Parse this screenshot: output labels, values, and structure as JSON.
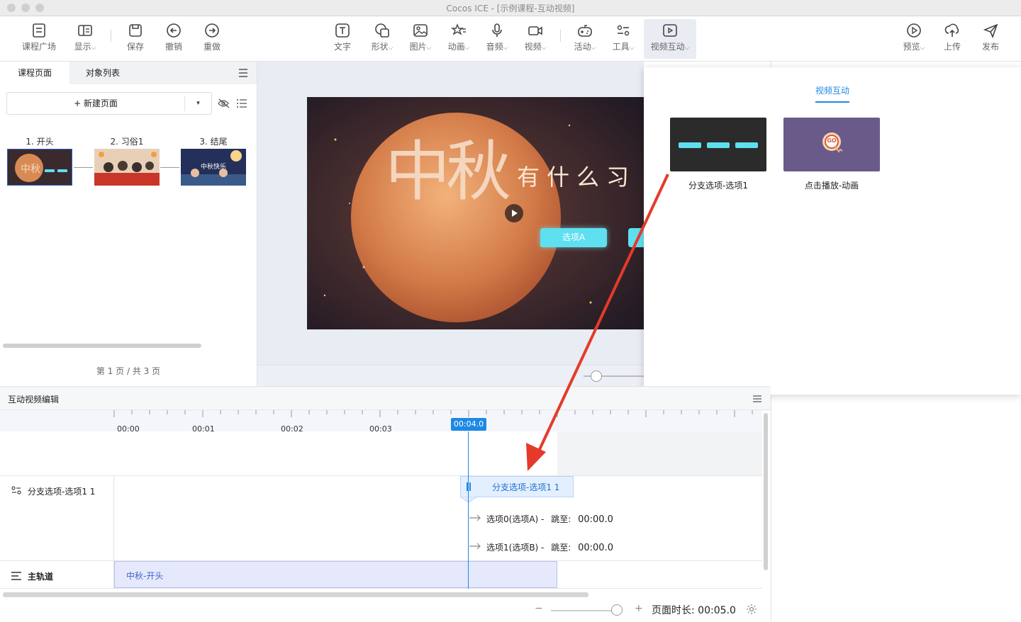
{
  "window": {
    "title": "Cocos ICE - [示例课程-互动视频]"
  },
  "toolbar": {
    "left": [
      {
        "label": "课程广场",
        "icon": "course-square-icon"
      },
      {
        "label": "显示",
        "icon": "display-icon",
        "dropdown": true
      },
      {
        "label": "保存",
        "icon": "save-icon"
      },
      {
        "label": "撤销",
        "icon": "undo-icon"
      },
      {
        "label": "重做",
        "icon": "redo-icon"
      }
    ],
    "center": [
      {
        "label": "文字",
        "icon": "text-icon"
      },
      {
        "label": "形状",
        "icon": "shape-icon",
        "dropdown": true
      },
      {
        "label": "图片",
        "icon": "image-icon",
        "dropdown": true
      },
      {
        "label": "动画",
        "icon": "animation-icon",
        "dropdown": true
      },
      {
        "label": "音频",
        "icon": "microphone-icon",
        "dropdown": true
      },
      {
        "label": "视频",
        "icon": "video-camera-icon",
        "dropdown": true
      },
      {
        "label": "活动",
        "icon": "gamepad-icon",
        "dropdown": true
      },
      {
        "label": "工具",
        "icon": "tools-icon",
        "dropdown": true
      },
      {
        "label": "视频互动",
        "icon": "video-interaction-icon",
        "dropdown": true,
        "active": true
      }
    ],
    "right": [
      {
        "label": "预览",
        "icon": "play-circle-icon",
        "dropdown": true
      },
      {
        "label": "上传",
        "icon": "upload-icon"
      },
      {
        "label": "发布",
        "icon": "send-icon"
      }
    ],
    "caret": "⌵"
  },
  "left_panel": {
    "tabs": [
      "课程页面",
      "对象列表"
    ],
    "new_page_label": "+ 新建页面",
    "dropdown_glyph": "▾",
    "pages": [
      {
        "title": "1. 开头"
      },
      {
        "title": "2. 习俗1"
      },
      {
        "title": "3. 结尾"
      }
    ],
    "page_counter": "第 1 页 / 共 3 页"
  },
  "stage": {
    "title_big": "中秋",
    "subtitle": "有什么习",
    "option_a": "选项A"
  },
  "popup": {
    "tab": "视频互动",
    "templates": [
      {
        "label": "分支选项-选项1"
      },
      {
        "label": "点击播放-动画",
        "badge": "GO"
      }
    ]
  },
  "timeline": {
    "title": "互动视频编辑",
    "ticks": [
      "00:00",
      "00:01",
      "00:02",
      "00:03"
    ],
    "playhead": "00:04.0",
    "tracks": [
      {
        "name": "分支选项-选项1 1"
      },
      {
        "name": "主轨道"
      }
    ],
    "branch_block_label": "分支选项-选项1 1",
    "options": [
      {
        "text": "选项0(选项A) -",
        "jump_label": "跳至:",
        "jump_time": "00:00.0"
      },
      {
        "text": "选项1(选项B) -",
        "jump_label": "跳至:",
        "jump_time": "00:00.0"
      }
    ],
    "main_clip": "中秋-开头",
    "duration_label": "页面时长:",
    "duration_value": "00:05.0",
    "zoom_minus": "−",
    "zoom_plus": "+"
  },
  "colors": {
    "accent": "#1e88e5",
    "arrow": "#e53a2a",
    "option_button": "#5ee0f0"
  }
}
